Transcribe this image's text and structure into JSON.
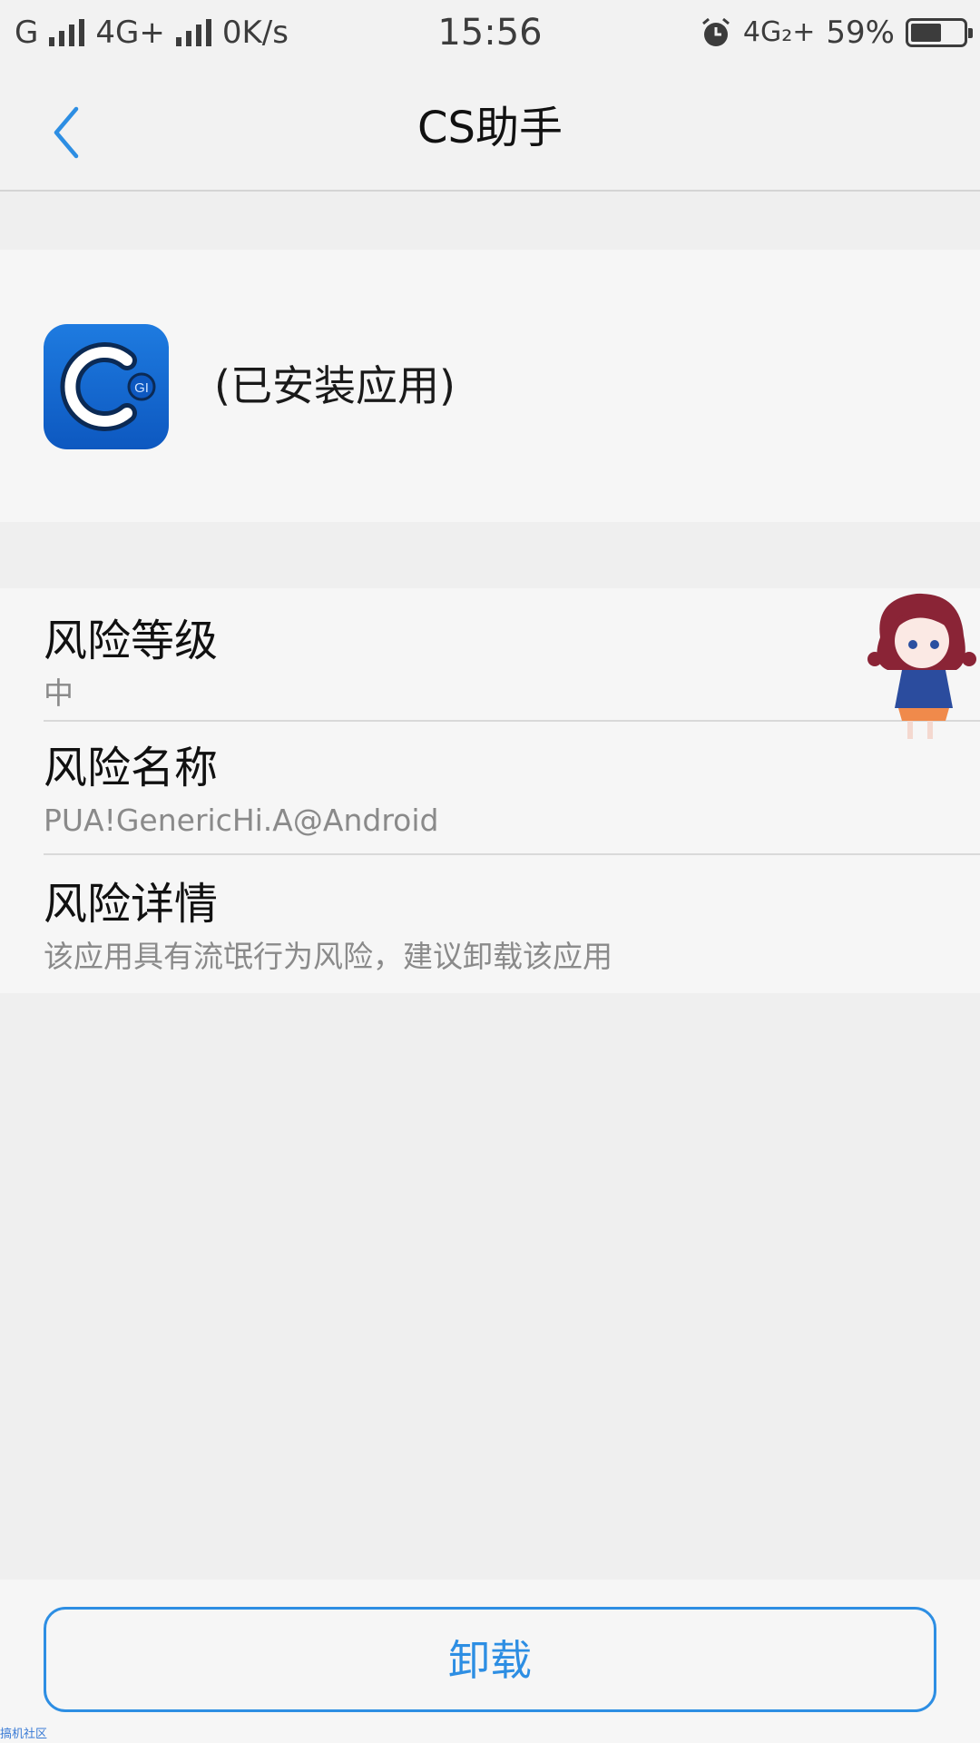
{
  "status_bar": {
    "carrier1": "G",
    "carrier2": "4G+",
    "speed": "0K/s",
    "time": "15:56",
    "network_right": "4G₂+",
    "battery_percent": "59%",
    "battery_level": 0.59
  },
  "nav": {
    "title": "CS助手"
  },
  "app": {
    "status": "(已安装应用)",
    "icon_letters": "C",
    "icon_badge": "GI",
    "icon_color": "#1e7be0"
  },
  "risk": {
    "level_label": "风险等级",
    "level_value": "中",
    "name_label": "风险名称",
    "name_value": "PUA!GenericHi.A@Android",
    "detail_label": "风险详情",
    "detail_value": "该应用具有流氓行为风险，建议卸载该应用"
  },
  "actions": {
    "uninstall_label": "卸载"
  },
  "watermark": "搞机社区",
  "colors": {
    "accent": "#2d8ee3",
    "background": "#efefef",
    "card": "#f6f6f6"
  }
}
